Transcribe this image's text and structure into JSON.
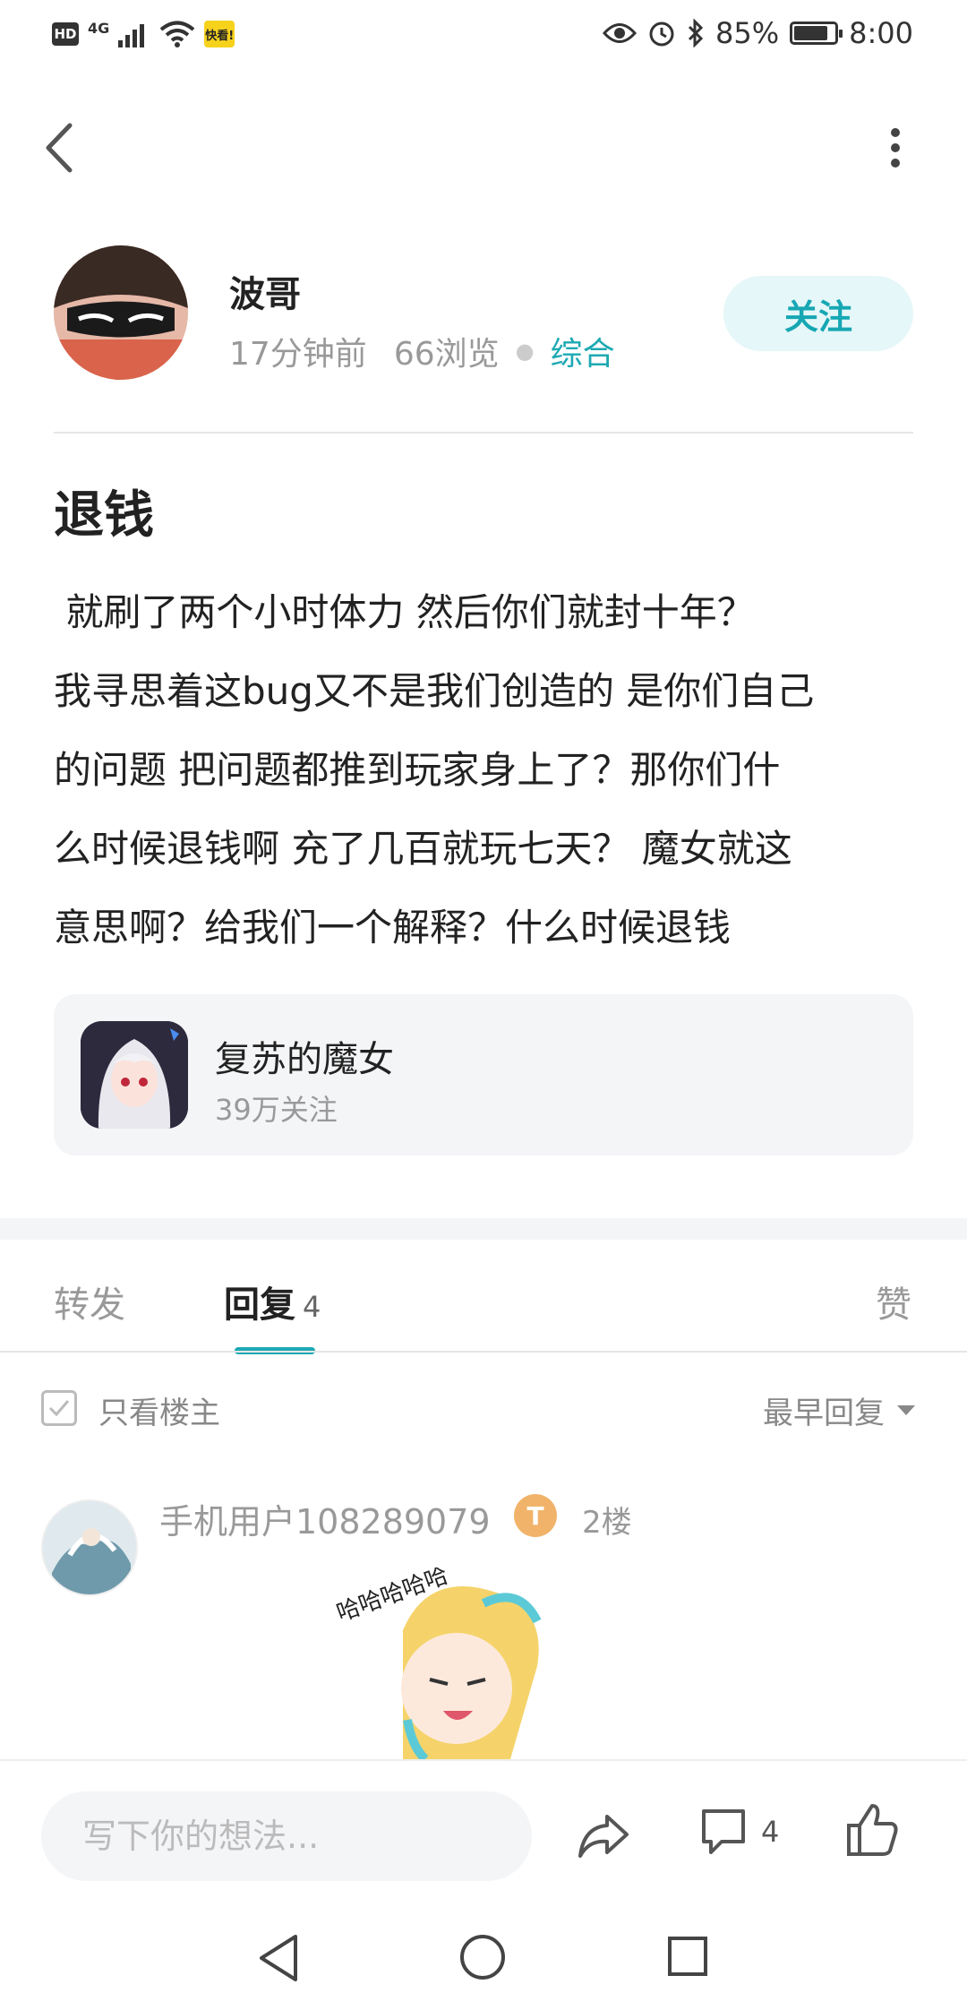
{
  "status_bar": {
    "hd": "HD",
    "network": "4G",
    "app_badge": "快看!",
    "battery_text": "85%",
    "battery_level": 0.85,
    "time": "8:00"
  },
  "author": {
    "name": "波哥",
    "time_ago": "17分钟前",
    "views": "66浏览",
    "category": "综合",
    "follow_label": "关注"
  },
  "post": {
    "title": "退钱",
    "body": " 就刷了两个小时体力 然后你们就封十年？\n我寻思着这bug又不是我们创造的 是你们自己\n的问题 把问题都推到玩家身上了？那你们什\n么时候退钱啊 充了几百就玩七天？ 魔女就这\n意思啊？给我们一个解释？什么时候退钱"
  },
  "game_card": {
    "name": "复苏的魔女",
    "followers": "39万关注"
  },
  "tabs": {
    "forward": "转发",
    "reply": "回复",
    "reply_count": "4",
    "like": "赞",
    "active": "reply"
  },
  "filter": {
    "only_op_label": "只看楼主",
    "only_op_checked": true,
    "sort_label": "最早回复"
  },
  "reply": {
    "user": "手机用户108289079",
    "level_badge": "T",
    "floor": "2楼",
    "sticker_text": "哈哈哈哈哈"
  },
  "bottom_bar": {
    "input_placeholder": "写下你的想法...",
    "comment_count": "4"
  },
  "colors": {
    "accent": "#1da9b3",
    "follow_bg": "#e5f7f8",
    "card_bg": "#f4f5f7",
    "muted": "#999999"
  },
  "icons": [
    "back-arrow-icon",
    "more-dots-icon",
    "share-icon",
    "comment-icon",
    "thumbs-up-icon",
    "check-icon",
    "chevron-down-icon",
    "nav-back-icon",
    "nav-home-icon",
    "nav-recent-icon",
    "eye-icon",
    "alarm-icon",
    "bluetooth-icon",
    "wifi-icon",
    "signal-icon",
    "battery-icon"
  ]
}
